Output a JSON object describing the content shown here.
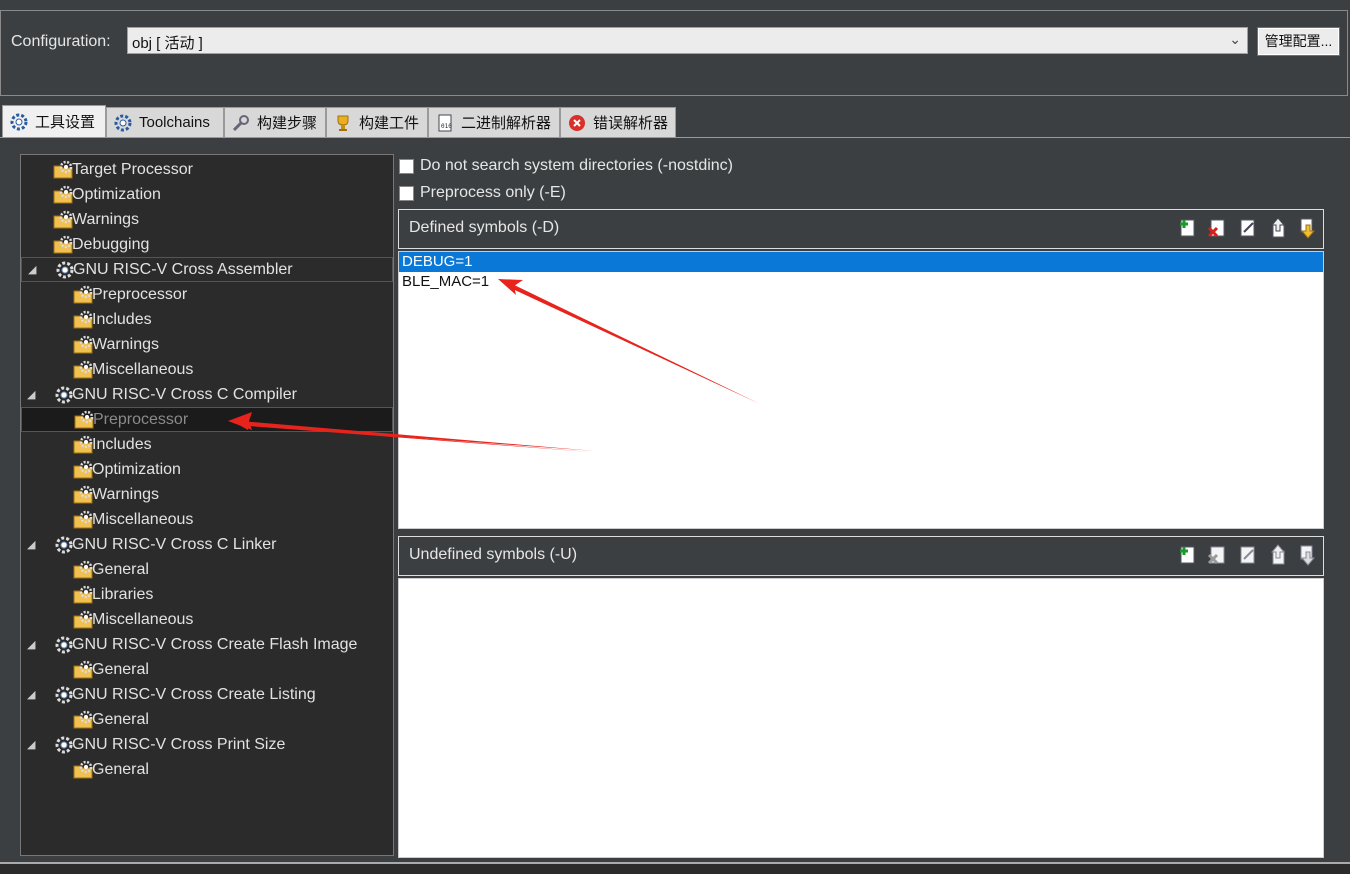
{
  "config": {
    "label": "Configuration:",
    "selected": "obj  [ 活动 ]",
    "manage_button": "管理配置..."
  },
  "tabs": [
    {
      "label": "工具设置",
      "icon": "gear-icon",
      "active": true
    },
    {
      "label": "Toolchains",
      "icon": "gear-icon",
      "active": false
    },
    {
      "label": "构建步骤",
      "icon": "wrench-icon",
      "active": false
    },
    {
      "label": "构建工件",
      "icon": "trophy-icon",
      "active": false
    },
    {
      "label": "二进制解析器",
      "icon": "binary-file-icon",
      "active": false
    },
    {
      "label": "错误解析器",
      "icon": "error-icon",
      "active": false
    }
  ],
  "tree": {
    "items": [
      {
        "label": "Target Processor"
      },
      {
        "label": "Optimization"
      },
      {
        "label": "Warnings"
      },
      {
        "label": "Debugging"
      },
      {
        "label": "GNU RISC-V Cross Assembler"
      },
      {
        "label": "Preprocessor"
      },
      {
        "label": "Includes"
      },
      {
        "label": "Warnings"
      },
      {
        "label": "Miscellaneous"
      },
      {
        "label": "GNU RISC-V Cross C Compiler"
      },
      {
        "label": "Preprocessor"
      },
      {
        "label": "Includes"
      },
      {
        "label": "Optimization"
      },
      {
        "label": "Warnings"
      },
      {
        "label": "Miscellaneous"
      },
      {
        "label": "GNU RISC-V Cross C Linker"
      },
      {
        "label": "General"
      },
      {
        "label": "Libraries"
      },
      {
        "label": "Miscellaneous"
      },
      {
        "label": "GNU RISC-V Cross Create Flash Image"
      },
      {
        "label": "General"
      },
      {
        "label": "GNU RISC-V Cross Create Listing"
      },
      {
        "label": "General"
      },
      {
        "label": "GNU RISC-V Cross Print Size"
      },
      {
        "label": "General"
      }
    ]
  },
  "options": {
    "nostdinc_label": "Do not search system directories (-nostdinc)",
    "preprocess_only_label": "Preprocess only (-E)"
  },
  "defined_symbols": {
    "title": "Defined symbols (-D)",
    "items": [
      "DEBUG=1",
      "BLE_MAC=1"
    ],
    "selected_index": 0
  },
  "undefined_symbols": {
    "title": "Undefined symbols (-U)",
    "items": []
  },
  "colors": {
    "background": "#3c3f41",
    "tree_background": "#2b2b2b",
    "selection": "#0a78d7",
    "annotation_arrow": "#e8231c"
  }
}
